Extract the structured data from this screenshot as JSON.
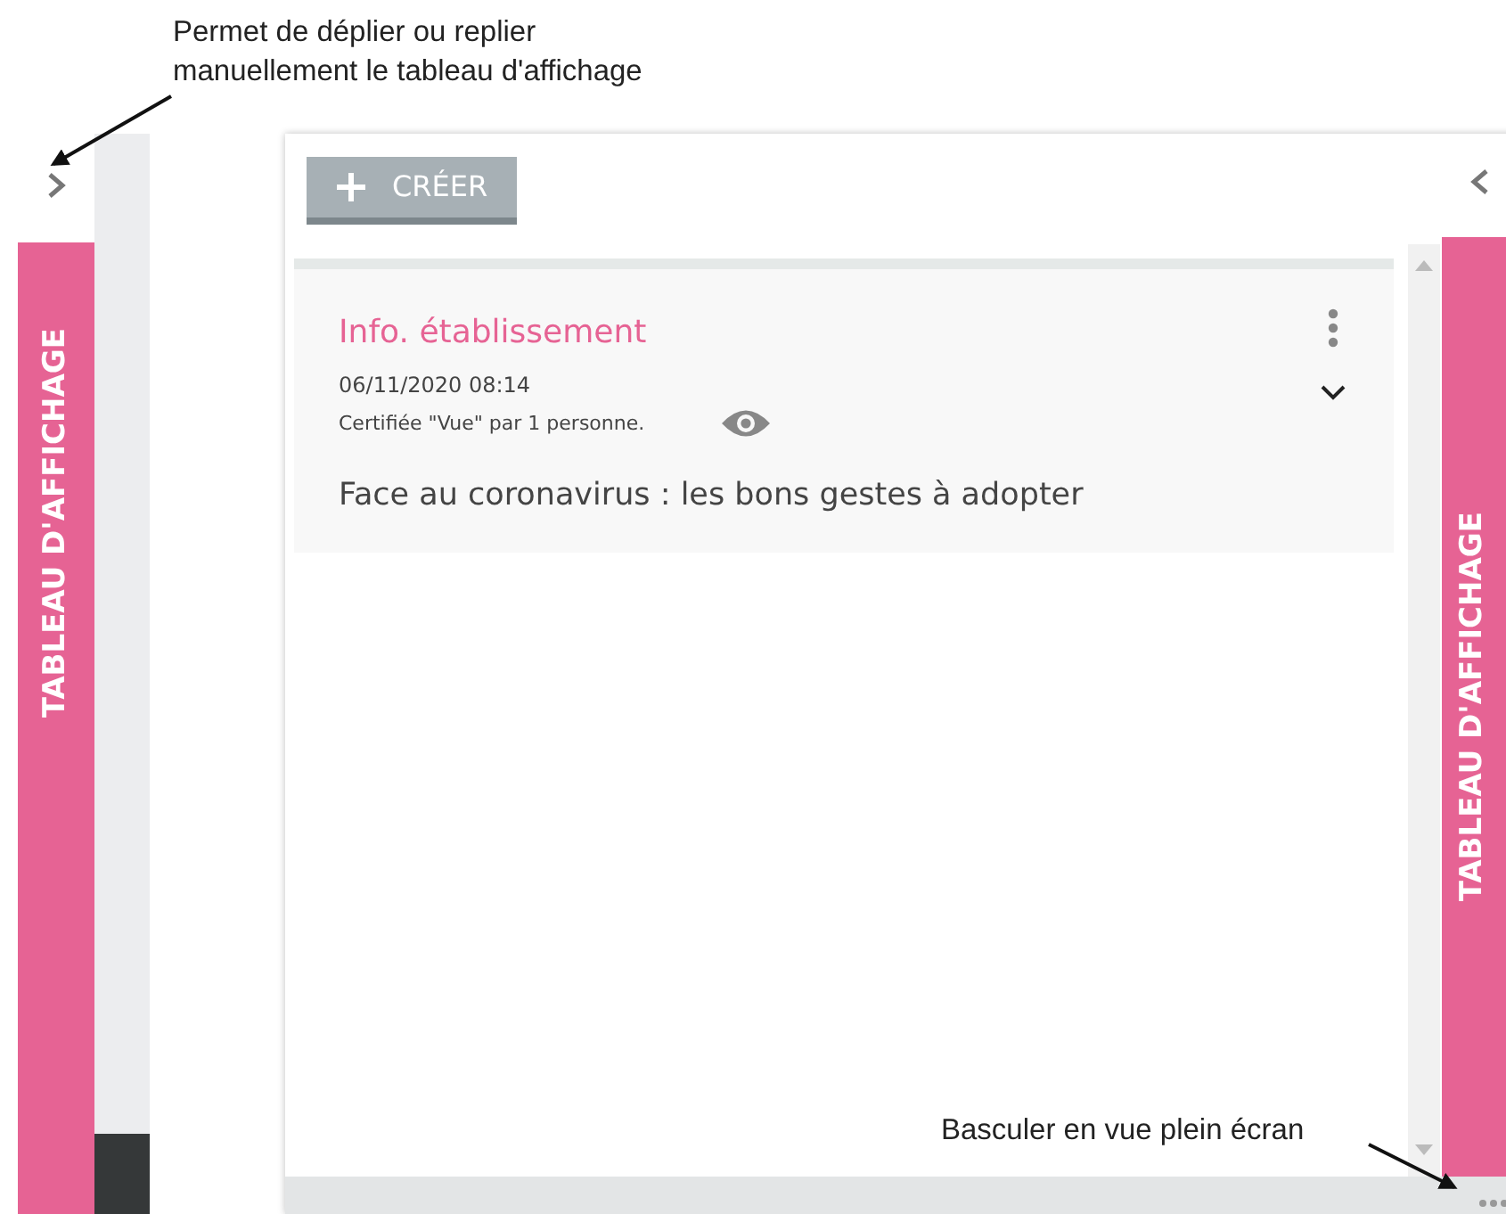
{
  "annotations": [
    {
      "text": "Permet de déplier ou replier manuellement le tableau d'affichage"
    },
    {
      "text": "Basculer en vue plein écran"
    }
  ],
  "collapsed_panel": {
    "label": "TABLEAU D'AFFICHAGE"
  },
  "board": {
    "create_button": "CRÉER",
    "side_label": "TABLEAU D'AFFICHAGE",
    "posts": [
      {
        "category": "Info. établissement",
        "date": "06/11/2020 08:14",
        "seen_by": "Certifiée \"Vue\" par 1 personne.",
        "title": "Face au coronavirus : les bons gestes à adopter"
      }
    ]
  }
}
